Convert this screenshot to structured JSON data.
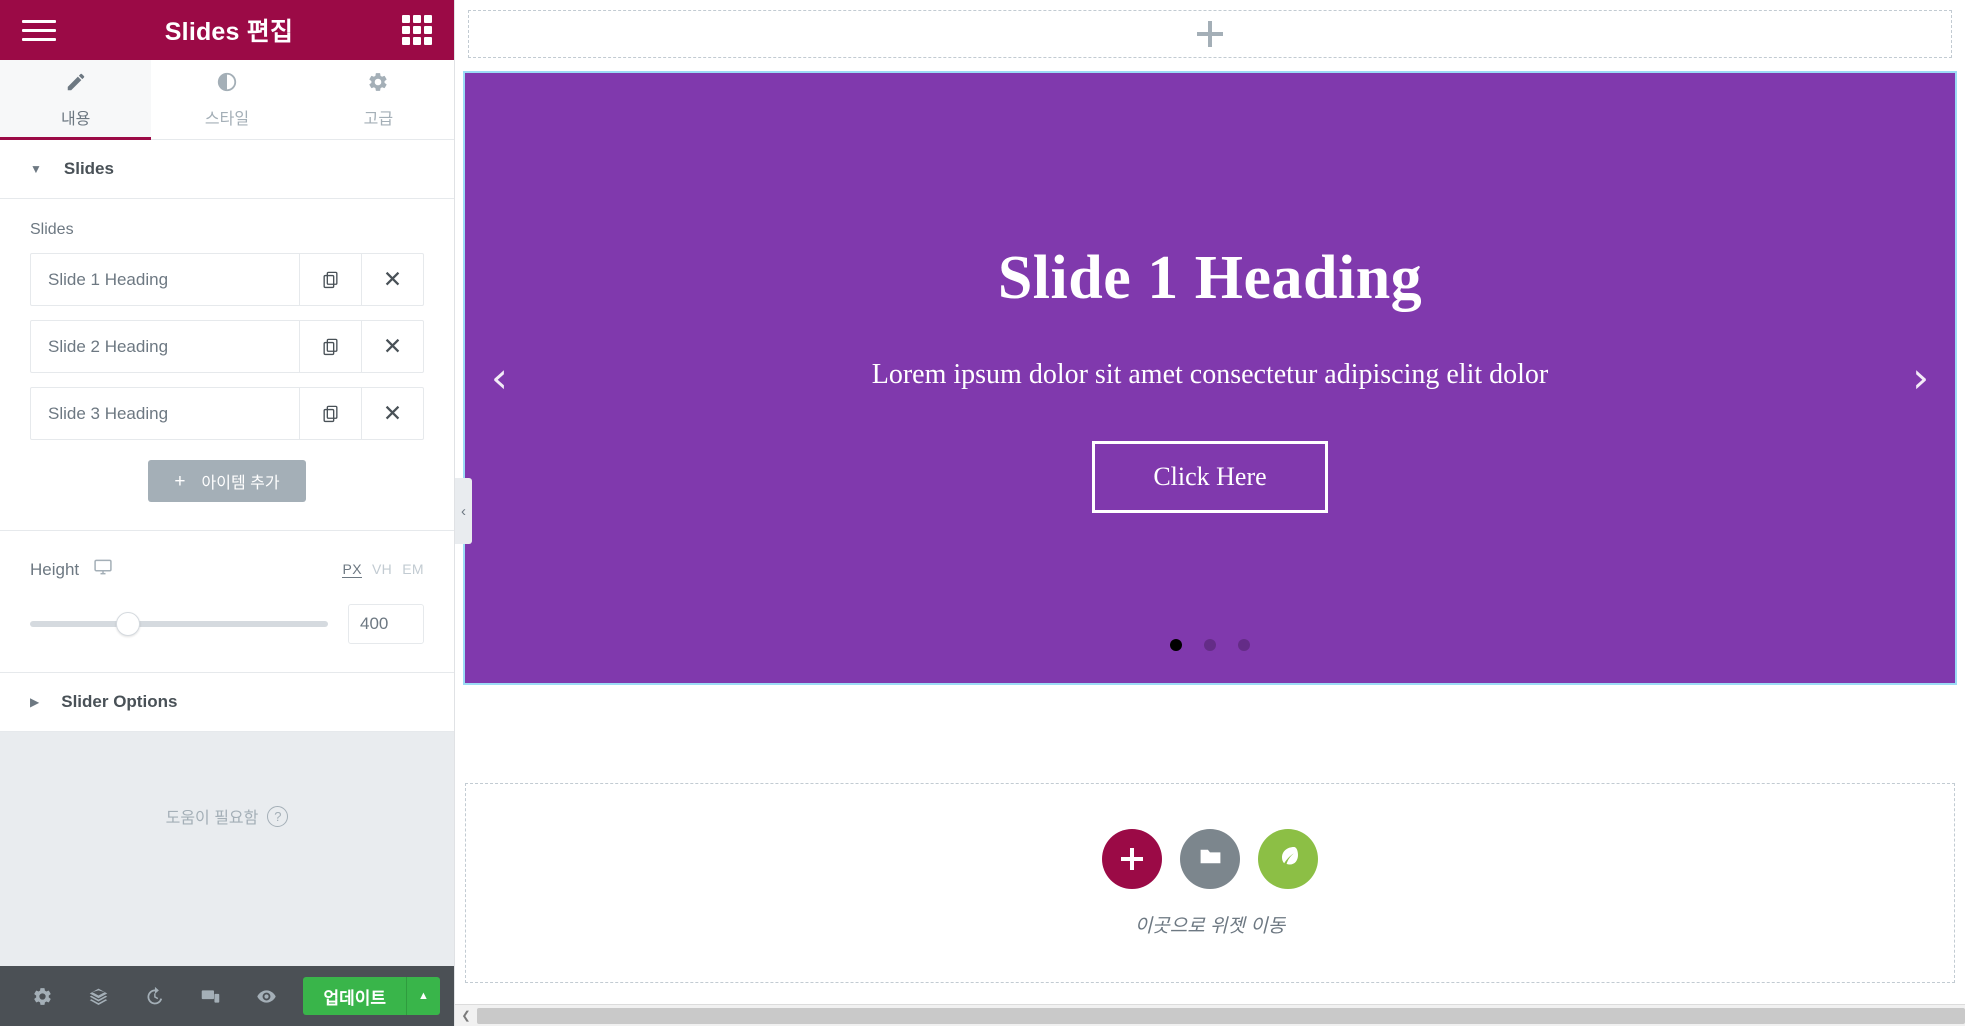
{
  "panel": {
    "header": {
      "title": "Slides 편집",
      "menu_icon": "hamburger-icon",
      "apps_icon": "grid-apps-icon"
    },
    "tabs": [
      {
        "label": "내용",
        "icon": "pencil-icon",
        "active": true
      },
      {
        "label": "스타일",
        "icon": "contrast-icon",
        "active": false
      },
      {
        "label": "고급",
        "icon": "gear-icon",
        "active": false
      }
    ],
    "sections": [
      {
        "title": "Slides",
        "expanded": true,
        "field_label": "Slides",
        "items": [
          {
            "title": "Slide 1 Heading"
          },
          {
            "title": "Slide 2 Heading"
          },
          {
            "title": "Slide 3 Heading"
          }
        ],
        "add_item_label": "아이템 추가",
        "height_control": {
          "label": "Height",
          "device_icon": "desktop-icon",
          "units": [
            "PX",
            "VH",
            "EM"
          ],
          "active_unit": "PX",
          "value": "400",
          "slider_percent": 33
        }
      },
      {
        "title": "Slider Options",
        "expanded": false
      }
    ],
    "help": {
      "label": "도움이 필요함",
      "icon": "question-circle-icon"
    },
    "footer": {
      "icons": [
        "gear-icon",
        "layers-icon",
        "history-icon",
        "responsive-icon",
        "eye-preview-icon"
      ],
      "update_label": "업데이트",
      "update_color": "#39b54a",
      "caret_icon": "caret-up-icon"
    }
  },
  "canvas": {
    "add_section": {
      "icon": "plus-icon"
    },
    "slide": {
      "background_color": "#8039ad",
      "heading": "Slide 1 Heading",
      "subheading": "Lorem ipsum dolor sit amet consectetur adipiscing elit dolor",
      "cta_label": "Click Here",
      "prev_icon": "chevron-left-icon",
      "next_icon": "chevron-right-icon",
      "dots": 3,
      "active_dot": 1
    },
    "drop_zone": {
      "text": "이곳으로 위젯 이동",
      "buttons": [
        {
          "name": "add-new-section",
          "icon": "plus-icon",
          "color": "#9b0a46"
        },
        {
          "name": "add-template",
          "icon": "folder-icon",
          "color": "#7c868d"
        },
        {
          "name": "envato-kit",
          "icon": "leaf-icon",
          "color": "#8cbf45"
        }
      ]
    },
    "collapse_handle_icon": "chevron-left-icon",
    "scrollbar": {
      "left_arrow_icon": "chevron-left-icon"
    }
  }
}
